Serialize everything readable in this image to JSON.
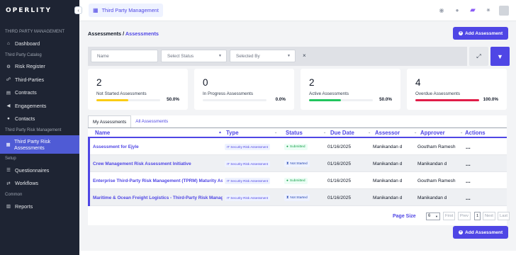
{
  "sidebar": {
    "logo": "OPERLITY",
    "collapse_icon": "chevron-left-icon",
    "sections": {
      "third_party_management": "THIRD PARTY MANAGEMENT",
      "third_party_catalog": "Third Party Catalog",
      "third_party_risk_management": "Third Party Risk Management",
      "setup": "Setup",
      "common": "Common"
    },
    "items": {
      "dashboard": "Dashboard",
      "risk_register": "Risk Register",
      "third_parties": "Third-Parties",
      "contracts": "Contracts",
      "engagements": "Engagements",
      "contacts": "Contacts",
      "tprm_assessments": "Third Party Risk Assessments",
      "questionnaires": "Questionnaires",
      "workflows": "Workflows",
      "reports": "Reports"
    }
  },
  "topbar": {
    "tab_label": "Third Party Management",
    "icons": [
      "settings-icon",
      "theme-icon",
      "chat-icon",
      "sun-icon",
      "avatar"
    ]
  },
  "breadcrumb": {
    "root": "Assessments",
    "separator": "/",
    "current": "Assessments"
  },
  "actions": {
    "add_assessment": "Add Assessment"
  },
  "filters": {
    "name_placeholder": "Name",
    "status_placeholder": "Select Status",
    "selected_by_placeholder": "Selected By",
    "clear": "×"
  },
  "summary_cards": [
    {
      "count": "2",
      "label": "Not Started Assessments",
      "percent_text": "50.0%",
      "percent": 50,
      "color": "#facc15"
    },
    {
      "count": "0",
      "label": "In Progress Assessments",
      "percent_text": "0.0%",
      "percent": 0,
      "color": "#3b82f6"
    },
    {
      "count": "2",
      "label": "Active Assessments",
      "percent_text": "50.0%",
      "percent": 50,
      "color": "#22c55e"
    },
    {
      "count": "4",
      "label": "Overdue Assessments",
      "percent_text": "100.0%",
      "percent": 100,
      "color": "#e11d48"
    }
  ],
  "tabs": {
    "my": "My Assessments",
    "all": "All Assessments"
  },
  "table": {
    "headers": {
      "name": "Name",
      "type": "Type",
      "status": "Status",
      "due_date": "Due Date",
      "assessor": "Assessor",
      "approver": "Approver",
      "actions": "Actions"
    },
    "rows": [
      {
        "name": "Assessment for Ejyle",
        "type": "IT Security Risk Assessment",
        "status": "Submitted",
        "due_date": "01/16/2025",
        "assessor": "Manikandan d",
        "approver": "Goutham Ramesh",
        "actions": "..."
      },
      {
        "name": "Crew Management Risk Assessment Initiative",
        "type": "IT Security Risk Assessment",
        "status": "Not Started",
        "due_date": "01/16/2025",
        "assessor": "Manikandan d",
        "approver": "Manikandan d",
        "actions": "..."
      },
      {
        "name": "Enterprise Third-Party Risk Management (TPRM) Maturity As...",
        "type": "IT Security Risk Assessment",
        "status": "Submitted",
        "due_date": "01/16/2025",
        "assessor": "Manikandan d",
        "approver": "Goutham Ramesh",
        "actions": "..."
      },
      {
        "name": "Maritime & Ocean Freight Logistics - Third-Party Risk Manag...",
        "type": "IT Security Risk Assessment",
        "status": "Not Started",
        "due_date": "01/16/2025",
        "assessor": "Manikandan d",
        "approver": "Manikandan d",
        "actions": "..."
      }
    ]
  },
  "pagination": {
    "label": "Page Size",
    "size": "6",
    "first": "First",
    "prev": "Prev",
    "page": "1",
    "next": "Next",
    "last": "Last"
  }
}
